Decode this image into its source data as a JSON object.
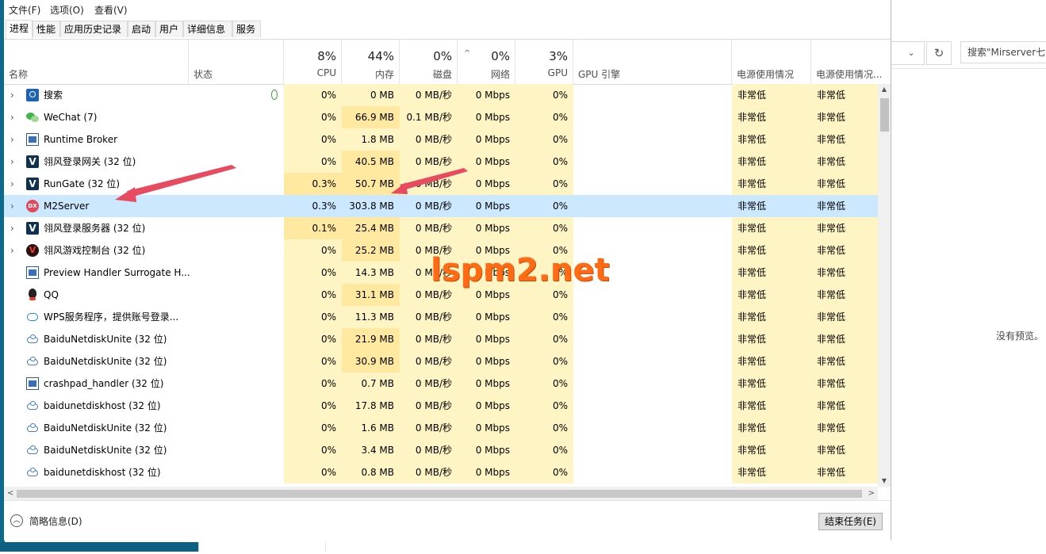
{
  "background_window": {
    "search_placeholder": "搜索\"Mirserver七",
    "dropdown_icon": "chevron-down",
    "refresh_icon": "refresh",
    "preview_text": "没有预览。"
  },
  "menu": [
    "文件(F)",
    "选项(O)",
    "查看(V)"
  ],
  "tabs": [
    "进程",
    "性能",
    "应用历史记录",
    "启动",
    "用户",
    "详细信息",
    "服务"
  ],
  "active_tab": "进程",
  "columns": {
    "name": "名称",
    "status": "状态",
    "cpu": {
      "pct": "8%",
      "label": "CPU"
    },
    "memory": {
      "pct": "44%",
      "label": "内存"
    },
    "disk": {
      "pct": "0%",
      "label": "磁盘"
    },
    "network": {
      "pct": "0%",
      "label": "网络"
    },
    "gpu": {
      "pct": "3%",
      "label": "GPU"
    },
    "gpu_engine": "GPU 引擎",
    "power": "电源使用情况",
    "power_trend": "电源使用情况..."
  },
  "processes": [
    {
      "name": "搜索",
      "icon": "search",
      "expand": true,
      "leaf": true,
      "cpu": "0%",
      "mem": "0 MB",
      "disk": "0 MB/秒",
      "net": "0 Mbps",
      "gpu": "0%",
      "power": "非常低",
      "power_trend": "非常低"
    },
    {
      "name": "WeChat (7)",
      "icon": "wechat",
      "expand": true,
      "cpu": "0%",
      "mem": "66.9 MB",
      "disk": "0.1 MB/秒",
      "net": "0 Mbps",
      "gpu": "0%",
      "power": "非常低",
      "power_trend": "非常低"
    },
    {
      "name": "Runtime Broker",
      "icon": "window",
      "expand": true,
      "cpu": "0%",
      "mem": "1.8 MB",
      "disk": "0 MB/秒",
      "net": "0 Mbps",
      "gpu": "0%",
      "power": "非常低",
      "power_trend": "非常低"
    },
    {
      "name": "翎风登录网关 (32 位)",
      "icon": "v",
      "expand": true,
      "cpu": "0%",
      "mem": "40.5 MB",
      "disk": "0 MB/秒",
      "net": "0 Mbps",
      "gpu": "0%",
      "power": "非常低",
      "power_trend": "非常低"
    },
    {
      "name": "RunGate (32 位)",
      "icon": "v",
      "expand": true,
      "cpu": "0.3%",
      "mem": "50.7 MB",
      "disk": "0 MB/秒",
      "net": "0 Mbps",
      "gpu": "0%",
      "power": "非常低",
      "power_trend": "非常低"
    },
    {
      "name": "M2Server",
      "icon": "dx",
      "expand": true,
      "selected": true,
      "cpu": "0.3%",
      "mem": "303.8 MB",
      "disk": "0 MB/秒",
      "net": "0 Mbps",
      "gpu": "0%",
      "power": "非常低",
      "power_trend": "非常低"
    },
    {
      "name": "翎风登录服务器 (32 位)",
      "icon": "v",
      "expand": true,
      "cpu": "0.1%",
      "mem": "25.4 MB",
      "disk": "0 MB/秒",
      "net": "0 Mbps",
      "gpu": "0%",
      "power": "非常低",
      "power_trend": "非常低"
    },
    {
      "name": "翎风游戏控制台 (32 位)",
      "icon": "vred",
      "expand": true,
      "cpu": "0%",
      "mem": "25.2 MB",
      "disk": "0 MB/秒",
      "net": "0 Mbps",
      "gpu": "0%",
      "power": "非常低",
      "power_trend": "非常低"
    },
    {
      "name": "Preview Handler Surrogate H...",
      "icon": "window",
      "cpu": "0%",
      "mem": "14.3 MB",
      "disk": "0 MB/秒",
      "net": "0 Mbps",
      "gpu": "0%",
      "power": "非常低",
      "power_trend": "非常低"
    },
    {
      "name": "QQ",
      "icon": "qq",
      "cpu": "0%",
      "mem": "31.1 MB",
      "disk": "0 MB/秒",
      "net": "0 Mbps",
      "gpu": "0%",
      "power": "非常低",
      "power_trend": "非常低"
    },
    {
      "name": "WPS服务程序，提供账号登录...",
      "icon": "cloud",
      "cpu": "0%",
      "mem": "11.3 MB",
      "disk": "0 MB/秒",
      "net": "0 Mbps",
      "gpu": "0%",
      "power": "非常低",
      "power_trend": "非常低"
    },
    {
      "name": "BaiduNetdiskUnite (32 位)",
      "icon": "baidu",
      "cpu": "0%",
      "mem": "21.9 MB",
      "disk": "0 MB/秒",
      "net": "0 Mbps",
      "gpu": "0%",
      "power": "非常低",
      "power_trend": "非常低"
    },
    {
      "name": "BaiduNetdiskUnite (32 位)",
      "icon": "baidu",
      "cpu": "0%",
      "mem": "30.9 MB",
      "disk": "0 MB/秒",
      "net": "0 Mbps",
      "gpu": "0%",
      "power": "非常低",
      "power_trend": "非常低"
    },
    {
      "name": "crashpad_handler (32 位)",
      "icon": "window",
      "cpu": "0%",
      "mem": "0.7 MB",
      "disk": "0 MB/秒",
      "net": "0 Mbps",
      "gpu": "0%",
      "power": "非常低",
      "power_trend": "非常低"
    },
    {
      "name": "baidunetdiskhost (32 位)",
      "icon": "baidu",
      "cpu": "0%",
      "mem": "17.8 MB",
      "disk": "0 MB/秒",
      "net": "0 Mbps",
      "gpu": "0%",
      "power": "非常低",
      "power_trend": "非常低"
    },
    {
      "name": "BaiduNetdiskUnite (32 位)",
      "icon": "baidu",
      "cpu": "0%",
      "mem": "1.6 MB",
      "disk": "0 MB/秒",
      "net": "0 Mbps",
      "gpu": "0%",
      "power": "非常低",
      "power_trend": "非常低"
    },
    {
      "name": "BaiduNetdiskUnite (32 位)",
      "icon": "baidu",
      "cpu": "0%",
      "mem": "3.4 MB",
      "disk": "0 MB/秒",
      "net": "0 Mbps",
      "gpu": "0%",
      "power": "非常低",
      "power_trend": "非常低"
    },
    {
      "name": "baidunetdiskhost (32 位)",
      "icon": "baidu",
      "cpu": "0%",
      "mem": "0.8 MB",
      "disk": "0 MB/秒",
      "net": "0 Mbps",
      "gpu": "0%",
      "power": "非常低",
      "power_trend": "非常低"
    }
  ],
  "footer": {
    "fewer_details": "简略信息(D)",
    "end_task": "结束任务(E)"
  },
  "watermark": "lspm2.net",
  "colors": {
    "heat_light": "#fff4c4",
    "heat_medium": "#ffe8a0",
    "selected_row": "#cce8ff",
    "annotation_arrow": "#e84a5f",
    "watermark": "#ff6a14"
  }
}
